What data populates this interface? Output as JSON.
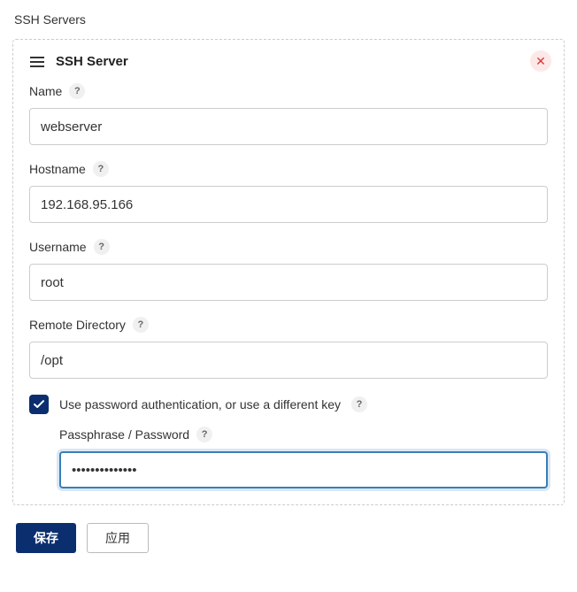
{
  "page_title": "SSH Servers",
  "panel": {
    "title": "SSH Server",
    "close_glyph": "✕"
  },
  "fields": {
    "name": {
      "label": "Name",
      "value": "webserver"
    },
    "hostname": {
      "label": "Hostname",
      "value": "192.168.95.166"
    },
    "username": {
      "label": "Username",
      "value": "root"
    },
    "remote_dir": {
      "label": "Remote Directory",
      "value": "/opt"
    },
    "use_password": {
      "label": "Use password authentication, or use a different key",
      "checked": true
    },
    "passphrase": {
      "label": "Passphrase / Password",
      "value": "••••••••••••••"
    }
  },
  "help_glyph": "?",
  "buttons": {
    "save": "保存",
    "apply": "应用"
  }
}
